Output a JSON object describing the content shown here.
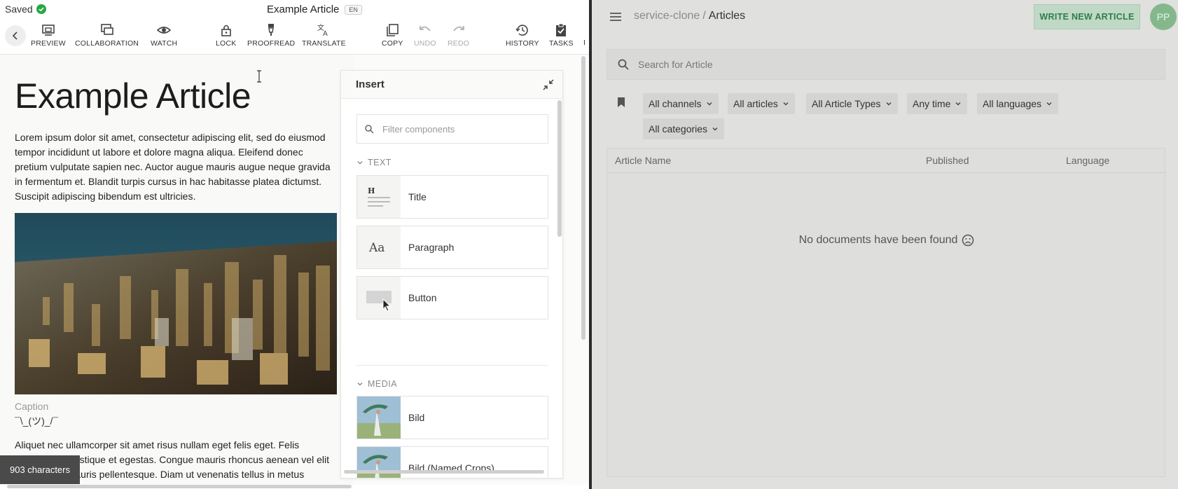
{
  "editor": {
    "status": "Saved",
    "doc_title": "Example Article",
    "language_badge": "EN",
    "toolbar": [
      {
        "label": "PREVIEW",
        "icon": "preview-icon"
      },
      {
        "label": "COLLABORATION",
        "icon": "collaboration-icon"
      },
      {
        "label": "WATCH",
        "icon": "eye-icon"
      },
      {
        "label": "LOCK",
        "icon": "lock-icon"
      },
      {
        "label": "PROOFREAD",
        "icon": "proofread-icon"
      },
      {
        "label": "TRANSLATE",
        "icon": "translate-icon"
      },
      {
        "label": "COPY",
        "icon": "copy-icon"
      },
      {
        "label": "UNDO",
        "icon": "undo-icon",
        "disabled": true
      },
      {
        "label": "REDO",
        "icon": "redo-icon",
        "disabled": true
      },
      {
        "label": "HISTORY",
        "icon": "history-icon"
      },
      {
        "label": "TASKS",
        "icon": "tasks-icon"
      },
      {
        "label": "I",
        "icon": "info-icon"
      }
    ],
    "article": {
      "title": "Example Article",
      "paragraph1_lines": [
        "Lorem ipsum dolor sit amet, consectetur adipiscing elit, sed do eiusmod",
        "tempor incididunt ut labore et dolore magna aliqua. Eleifend donec",
        "pretium vulputate sapien nec. Auctor augue mauris augue neque gravida",
        "in fermentum et. Blandit turpis cursus in hac habitasse platea dictumst.",
        "Suscipit adipiscing bibendum est ultricies."
      ],
      "caption": "Caption",
      "credit": "¯\\_(ツ)_/¯",
      "paragraph2_lines": [
        "Aliquet nec ullamcorper sit amet risus nullam eget felis eget. Felis",
        "bibendum ut tristique et egestas. Congue mauris rhoncus aenean vel elit",
        "scelerisque mauris pellentesque. Diam ut venenatis tellus in metus"
      ]
    },
    "char_count": "903 characters"
  },
  "insert_panel": {
    "title": "Insert",
    "filter_placeholder": "Filter components",
    "sections": [
      {
        "name": "TEXT",
        "components": [
          "Title",
          "Paragraph",
          "Button"
        ]
      },
      {
        "name": "MEDIA",
        "components": [
          "Bild",
          "Bild (Named Crops)"
        ]
      }
    ]
  },
  "list": {
    "breadcrumb_project": "service-clone",
    "breadcrumb_sep": "/",
    "breadcrumb_page": "Articles",
    "write_button": "WRITE NEW ARTICLE",
    "avatar_initials": "PP",
    "search_placeholder": "Search for Article",
    "filters": [
      "All channels",
      "All articles",
      "All Article Types",
      "Any time",
      "All languages",
      "All categories"
    ],
    "columns": [
      "Article Name",
      "Published",
      "Language"
    ],
    "empty_message": "No documents have been found"
  },
  "colors": {
    "accent_green": "#27a844",
    "write_button_text": "#2e7d4a",
    "avatar_bg": "#84b88c"
  }
}
